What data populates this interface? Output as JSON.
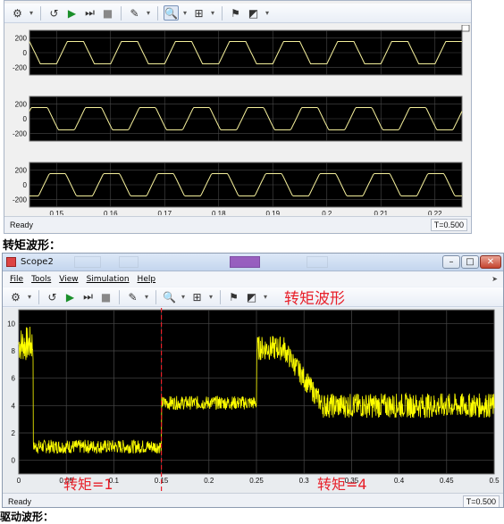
{
  "top_window": {
    "axes": [
      {
        "yticks": [
          "200",
          "0",
          "-200"
        ]
      },
      {
        "yticks": [
          "200",
          "0",
          "-200"
        ]
      },
      {
        "yticks": [
          "200",
          "0",
          "-200"
        ]
      }
    ],
    "xticks": [
      "0.15",
      "0.16",
      "0.17",
      "0.18",
      "0.19",
      "0.2",
      "0.21",
      "0.22"
    ],
    "status": "Ready",
    "time": "T=0.500"
  },
  "captions": {
    "torque": "转矩波形：",
    "bottom": "驱动波形："
  },
  "scope2": {
    "title": "Scope2",
    "menu": [
      "File",
      "Tools",
      "View",
      "Simulation",
      "Help"
    ],
    "overlay_title": "转矩波形",
    "status": "Ready",
    "time": "T=0.500",
    "annotations": [
      "转矩=1",
      "转矩=4"
    ]
  },
  "icons": {
    "toolbar": [
      "settings-icon",
      "back-icon",
      "run-icon",
      "step-icon",
      "stop-icon",
      "highlight-icon",
      "zoom-icon",
      "zoom-axes-icon",
      "autoscale-icon",
      "properties-icon"
    ]
  },
  "colors": {
    "trace": "#ffff00",
    "plot_bg": "#000000",
    "grid": "#4a4a4a",
    "annotation": "#e8202a",
    "divider": "#e8202a"
  },
  "chart_data": [
    {
      "type": "line",
      "xlim": [
        0.145,
        0.225
      ],
      "ylim": [
        -300,
        300
      ],
      "series": [
        {
          "description_only": false,
          "waveform": "trapezoid",
          "amplitude": 150,
          "period": 0.01,
          "phase": 0
        }
      ],
      "xticks": [
        0.15,
        0.16,
        0.17,
        0.18,
        0.19,
        0.2,
        0.21,
        0.22
      ],
      "yticks": [
        200,
        0,
        -200
      ]
    },
    {
      "type": "line",
      "xlim": [
        0.145,
        0.225
      ],
      "ylim": [
        -300,
        300
      ],
      "series": [
        {
          "waveform": "trapezoid",
          "amplitude": 150,
          "period": 0.01,
          "phase": 0.00333
        }
      ],
      "xticks": [
        0.15,
        0.16,
        0.17,
        0.18,
        0.19,
        0.2,
        0.21,
        0.22
      ],
      "yticks": [
        200,
        0,
        -200
      ]
    },
    {
      "type": "line",
      "xlim": [
        0.145,
        0.225
      ],
      "ylim": [
        -300,
        300
      ],
      "series": [
        {
          "waveform": "trapezoid",
          "amplitude": 150,
          "period": 0.01,
          "phase": 0.00667
        }
      ],
      "xticks": [
        0.15,
        0.16,
        0.17,
        0.18,
        0.19,
        0.2,
        0.21,
        0.22
      ],
      "yticks": [
        200,
        0,
        -200
      ]
    },
    {
      "type": "line",
      "xlim": [
        0,
        0.5
      ],
      "ylim": [
        -1,
        11
      ],
      "xticks": [
        0,
        0.05,
        0.1,
        0.15,
        0.2,
        0.25,
        0.3,
        0.35,
        0.4,
        0.45,
        0.5
      ],
      "yticks": [
        0,
        2,
        4,
        6,
        8,
        10
      ],
      "grid": true,
      "segments": [
        {
          "x0": 0,
          "x1": 0.015,
          "mean": 8.5,
          "noise": 1.3
        },
        {
          "x0": 0.015,
          "x1": 0.018,
          "mean": 1,
          "noise": 0.4
        },
        {
          "x0": 0.018,
          "x1": 0.15,
          "mean": 1,
          "noise": 0.5
        },
        {
          "x0": 0.15,
          "x1": 0.25,
          "mean": 4.2,
          "noise": 0.5
        },
        {
          "x0": 0.25,
          "x1": 0.28,
          "mean": 8.2,
          "noise": 0.9
        },
        {
          "x0": 0.28,
          "x1": 0.32,
          "mean": 6.0,
          "noise": 0.8
        },
        {
          "x0": 0.32,
          "x1": 0.5,
          "mean": 4.0,
          "noise": 0.9
        }
      ],
      "marker_x": 0.15
    }
  ]
}
